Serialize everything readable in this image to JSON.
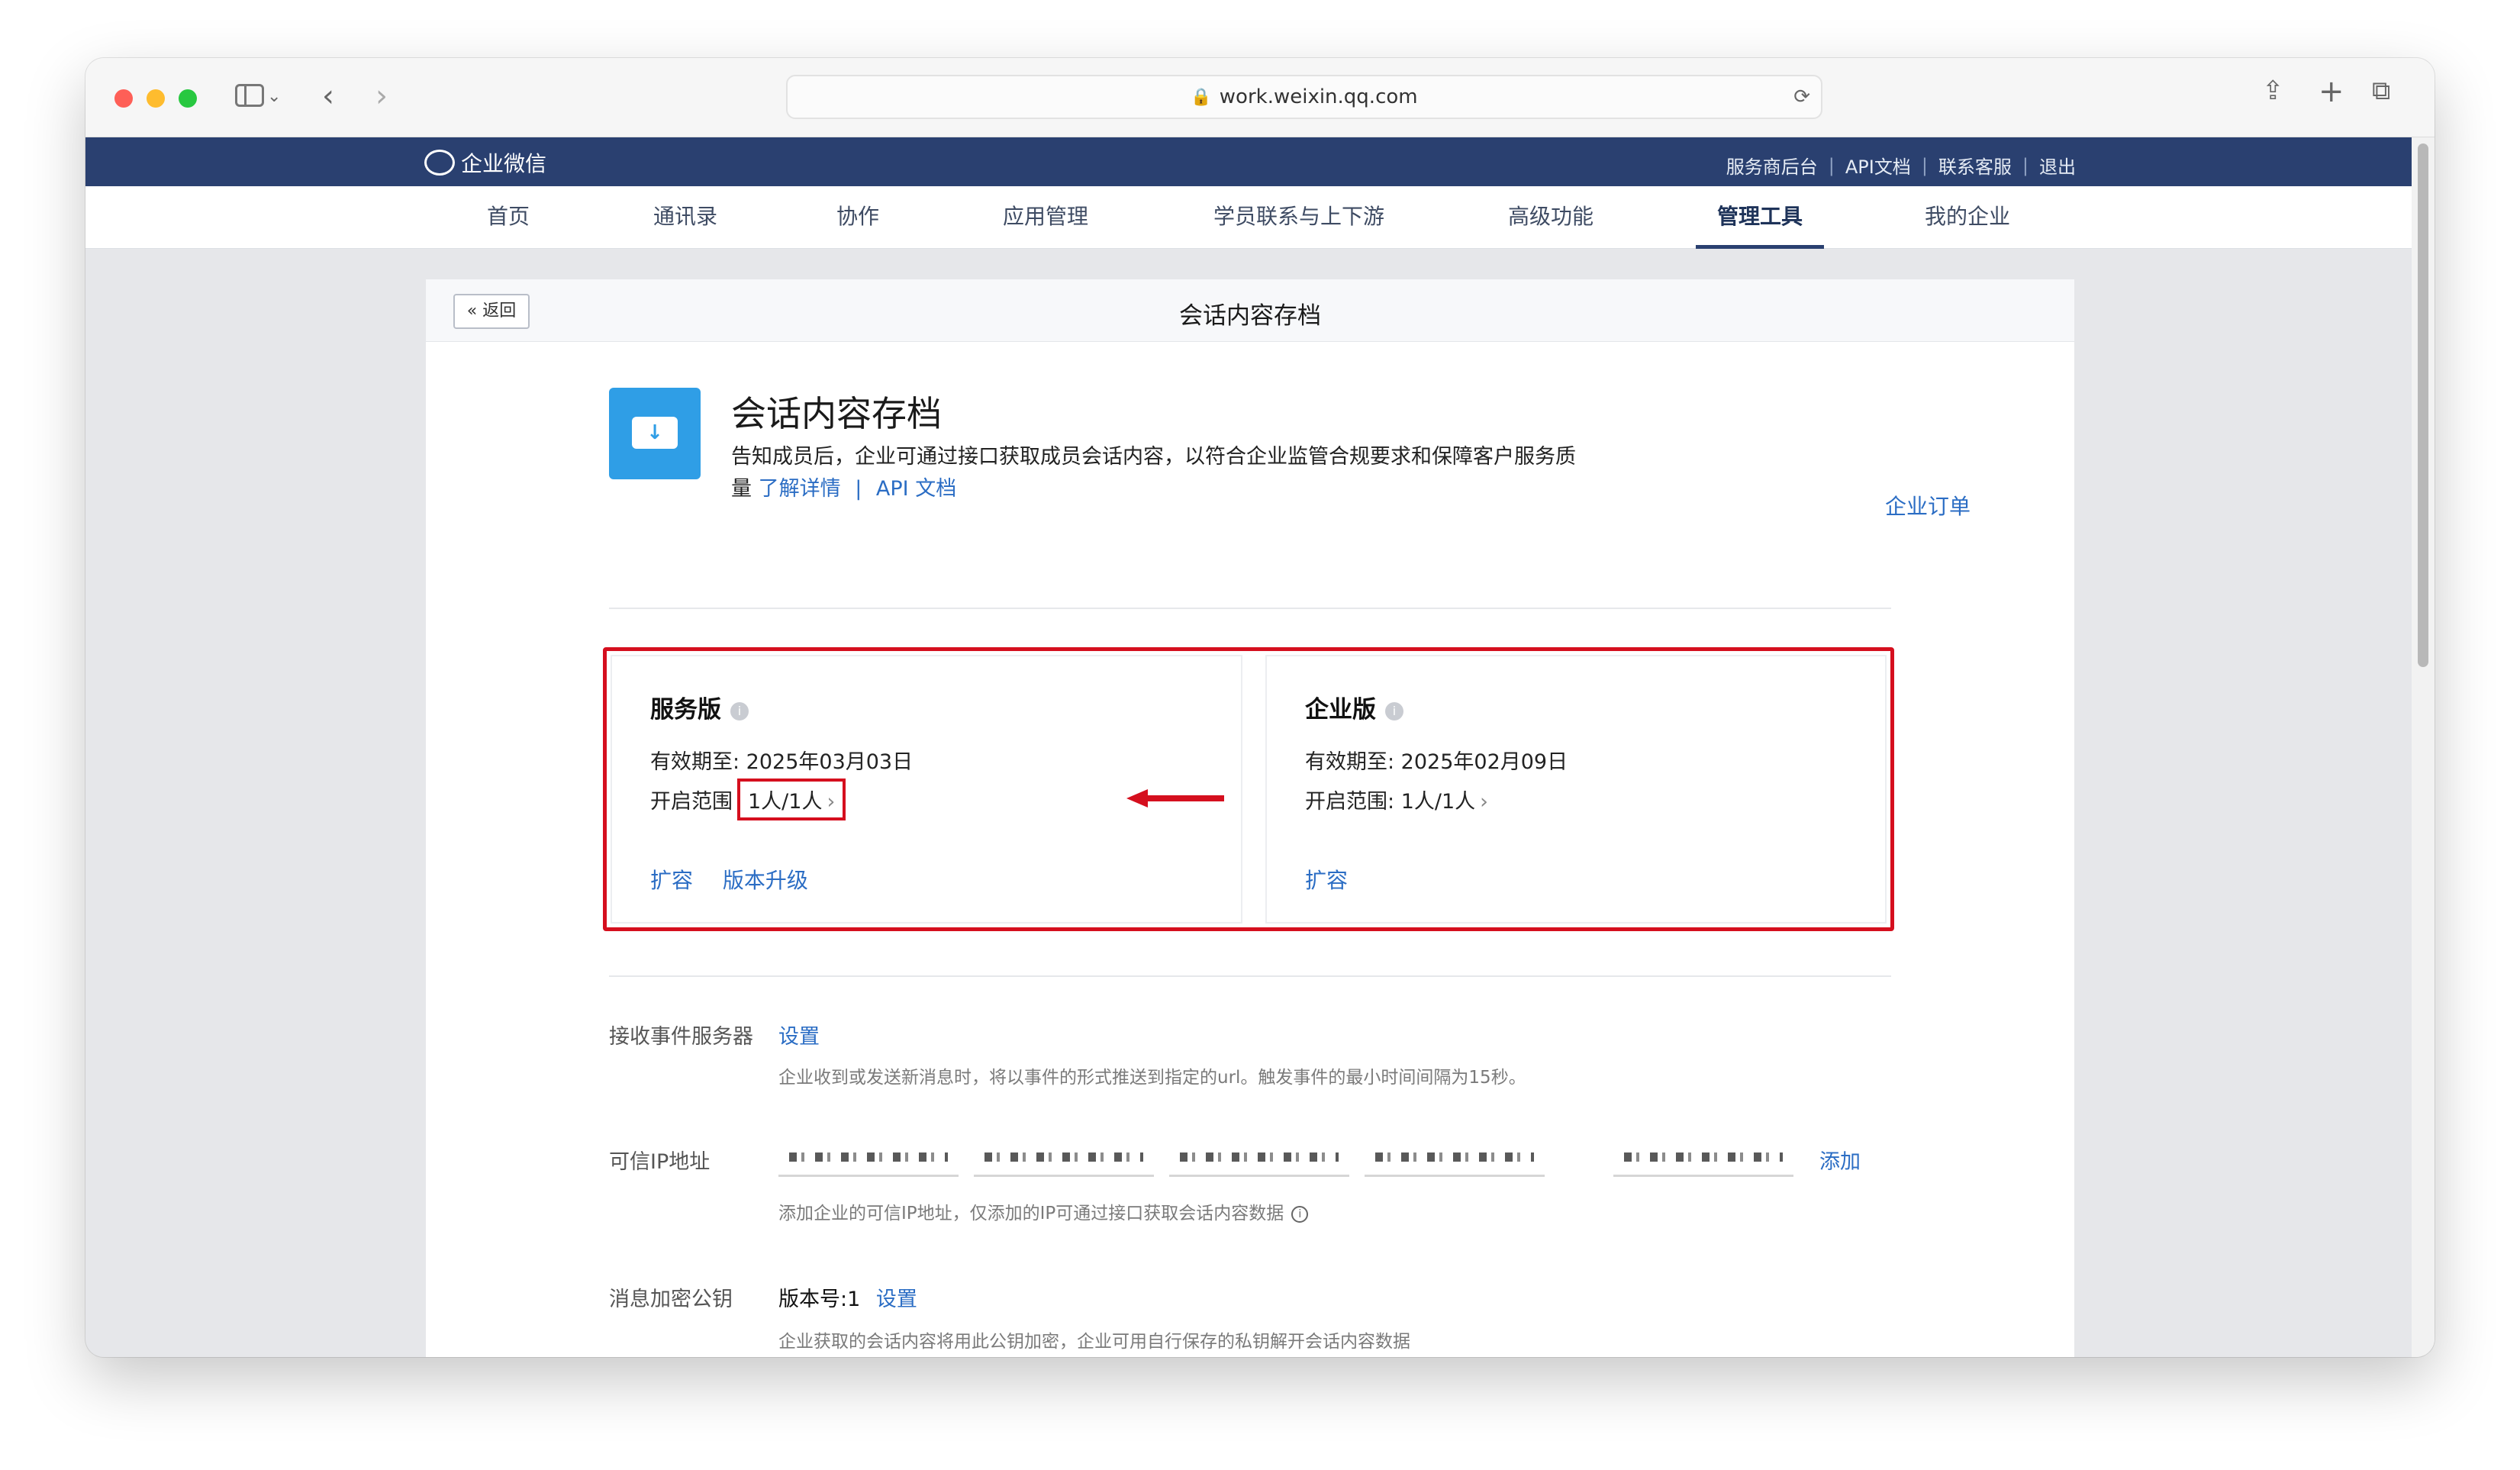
{
  "browser": {
    "url": "work.weixin.qq.com"
  },
  "site_header": {
    "logo_text": "企业微信",
    "links": [
      "服务商后台",
      "API文档",
      "联系客服",
      "退出"
    ]
  },
  "nav": {
    "items": [
      "首页",
      "通讯录",
      "协作",
      "应用管理",
      "学员联系与上下游",
      "高级功能",
      "管理工具",
      "我的企业"
    ],
    "active": "管理工具"
  },
  "page": {
    "back_label": "返回",
    "title": "会话内容存档"
  },
  "app": {
    "name": "会话内容存档",
    "description": "告知成员后，企业可通过接口获取成员会话内容，以符合企业监管合规要求和保障客户服务质",
    "description_cont": "量",
    "learn_more": "了解详情",
    "link_sep": "|",
    "api_doc": "API 文档",
    "order_link": "企业订单"
  },
  "editions": [
    {
      "name": "服务版",
      "expiry": "有效期至: 2025年03月03日",
      "scope_label": "开启范围",
      "scope_value": "1人/1人",
      "actions": [
        "扩容",
        "版本升级"
      ]
    },
    {
      "name": "企业版",
      "expiry": "有效期至: 2025年02月09日",
      "scope_label": "开启范围:",
      "scope_value": "1人/1人",
      "actions": [
        "扩容"
      ]
    }
  ],
  "settings": {
    "event_server": {
      "label": "接收事件服务器",
      "action": "设置",
      "hint": "企业收到或发送新消息时，将以事件的形式推送到指定的url。触发事件的最小时间间隔为15秒。"
    },
    "trusted_ip": {
      "label": "可信IP地址",
      "add": "添加",
      "hint": "添加企业的可信IP地址，仅添加的IP可通过接口获取会话内容数据"
    },
    "public_key": {
      "label": "消息加密公钥",
      "version": "版本号:1",
      "action": "设置",
      "hint": "企业获取的会话内容将用此公钥加密，企业可用自行保存的私钥解开会话内容数据"
    }
  },
  "colors": {
    "header_bg": "#2a4070",
    "link": "#2b6dc4",
    "highlight_red": "#d50f1e",
    "app_icon": "#2f9ee6"
  }
}
